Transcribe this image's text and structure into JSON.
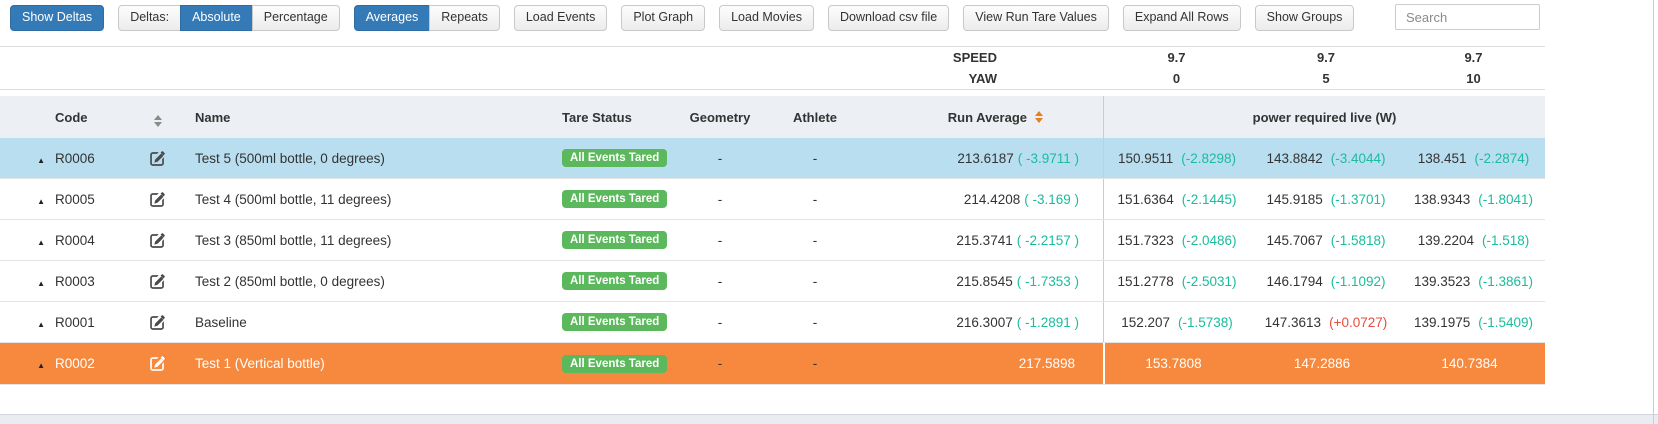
{
  "toolbar": {
    "show_deltas": "Show Deltas",
    "deltas_label": "Deltas:",
    "absolute": "Absolute",
    "percentage": "Percentage",
    "averages": "Averages",
    "repeats": "Repeats",
    "buttons": [
      "Load Events",
      "Plot Graph",
      "Load Movies",
      "Download csv file",
      "View Run Tare Values",
      "Expand All Rows",
      "Show Groups"
    ],
    "search_placeholder": "Search"
  },
  "conditions": {
    "speed_label": "SPEED",
    "yaw_label": "YAW",
    "speed_values": [
      "9.7",
      "9.7",
      "9.7"
    ],
    "yaw_values": [
      "0",
      "5",
      "10"
    ]
  },
  "table": {
    "headers": {
      "code": "Code",
      "name": "Name",
      "tare_status": "Tare Status",
      "geometry": "Geometry",
      "athlete": "Athlete",
      "run_average": "Run Average",
      "power_group": "power required live (W)"
    },
    "rows": [
      {
        "code": "R0006",
        "name": "Test 5 (500ml bottle, 0 degrees)",
        "tare": "All Events Tared",
        "geometry": "-",
        "athlete": "-",
        "run_avg": "213.6187",
        "run_avg_delta": "( -3.9711 )",
        "power": [
          {
            "v": "150.9511",
            "d": "(-2.8298)"
          },
          {
            "v": "143.8842",
            "d": "(-3.4044)"
          },
          {
            "v": "138.451",
            "d": "(-2.2874)"
          }
        ],
        "highlight": "selected"
      },
      {
        "code": "R0005",
        "name": "Test 4 (500ml bottle, 11 degrees)",
        "tare": "All Events Tared",
        "geometry": "-",
        "athlete": "-",
        "run_avg": "214.4208",
        "run_avg_delta": "( -3.169 )",
        "power": [
          {
            "v": "151.6364",
            "d": "(-2.1445)"
          },
          {
            "v": "145.9185",
            "d": "(-1.3701)"
          },
          {
            "v": "138.9343",
            "d": "(-1.8041)"
          }
        ],
        "highlight": ""
      },
      {
        "code": "R0004",
        "name": "Test 3 (850ml bottle, 11 degrees)",
        "tare": "All Events Tared",
        "geometry": "-",
        "athlete": "-",
        "run_avg": "215.3741",
        "run_avg_delta": "( -2.2157 )",
        "power": [
          {
            "v": "151.7323",
            "d": "(-2.0486)"
          },
          {
            "v": "145.7067",
            "d": "(-1.5818)"
          },
          {
            "v": "139.2204",
            "d": "(-1.518)"
          }
        ],
        "highlight": ""
      },
      {
        "code": "R0003",
        "name": "Test 2 (850ml bottle, 0 degrees)",
        "tare": "All Events Tared",
        "geometry": "-",
        "athlete": "-",
        "run_avg": "215.8545",
        "run_avg_delta": "( -1.7353 )",
        "power": [
          {
            "v": "151.2778",
            "d": "(-2.5031)"
          },
          {
            "v": "146.1794",
            "d": "(-1.1092)"
          },
          {
            "v": "139.3523",
            "d": "(-1.3861)"
          }
        ],
        "highlight": ""
      },
      {
        "code": "R0001",
        "name": "Baseline",
        "tare": "All Events Tared",
        "geometry": "-",
        "athlete": "-",
        "run_avg": "216.3007",
        "run_avg_delta": "( -1.2891 )",
        "power": [
          {
            "v": "152.207",
            "d": "(-1.5738)"
          },
          {
            "v": "147.3613",
            "d": "(+0.0727)"
          },
          {
            "v": "139.1975",
            "d": "(-1.5409)"
          }
        ],
        "highlight": ""
      },
      {
        "code": "R0002",
        "name": "Test 1 (Vertical bottle)",
        "tare": "All Events Tared",
        "geometry": "-",
        "athlete": "-",
        "run_avg": "217.5898",
        "run_avg_delta": "",
        "power": [
          {
            "v": "153.7808",
            "d": ""
          },
          {
            "v": "147.2886",
            "d": ""
          },
          {
            "v": "140.7384",
            "d": ""
          }
        ],
        "highlight": "orange"
      }
    ]
  },
  "colors": {
    "accent": "#337ab7",
    "row_highlight": "#b8def0",
    "row_warning": "#f6893d",
    "badge_green": "#5cb85c",
    "delta_green": "#1abc9c",
    "delta_red": "#e74c3c"
  }
}
